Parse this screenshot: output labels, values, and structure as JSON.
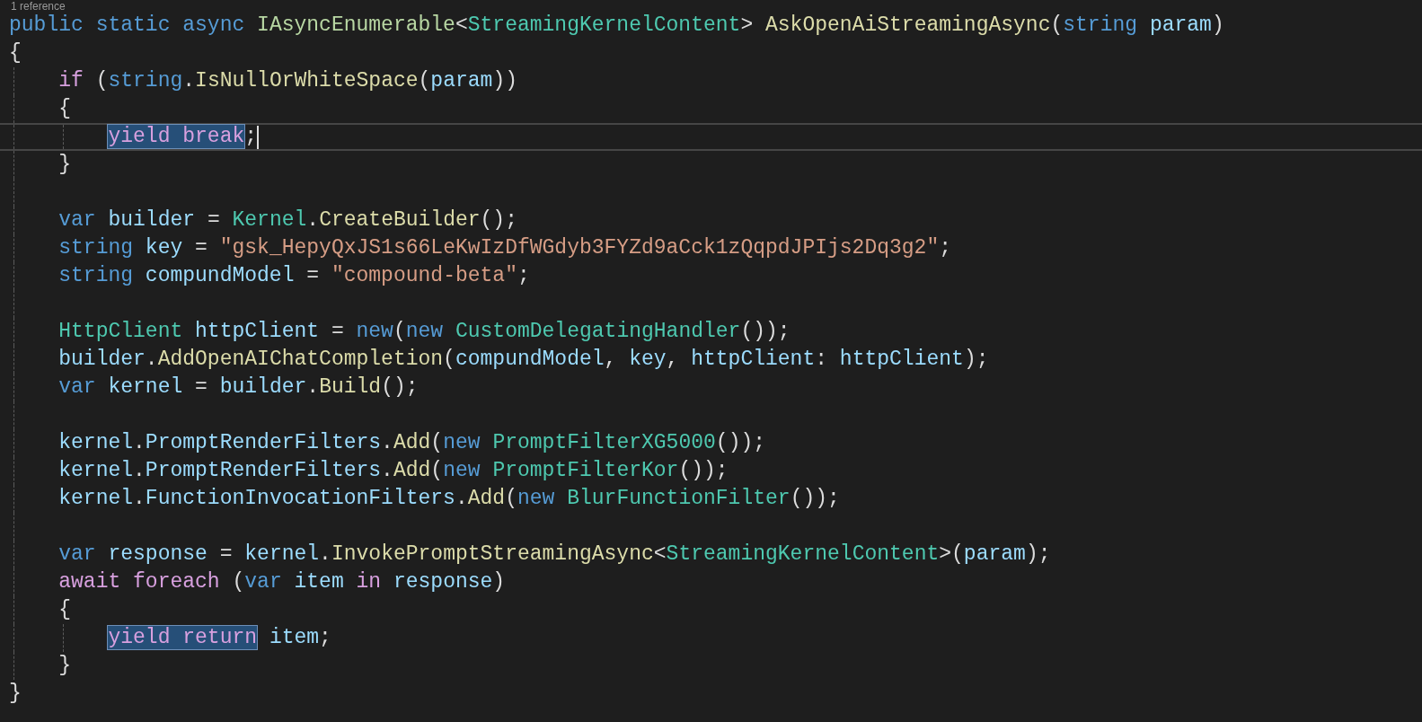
{
  "codelens": "1 reference",
  "lines": [
    {
      "current": false,
      "tokens": [
        {
          "kind": "keyword",
          "text": "public "
        },
        {
          "kind": "keyword",
          "text": "static "
        },
        {
          "kind": "keyword",
          "text": "async "
        },
        {
          "kind": "interface",
          "text": "IAsyncEnumerable"
        },
        {
          "kind": "punct",
          "text": "<"
        },
        {
          "kind": "type",
          "text": "StreamingKernelContent"
        },
        {
          "kind": "punct",
          "text": "> "
        },
        {
          "kind": "method",
          "text": "AskOpenAiStreamingAsync"
        },
        {
          "kind": "punct",
          "text": "("
        },
        {
          "kind": "keyword",
          "text": "string "
        },
        {
          "kind": "variable",
          "text": "param"
        },
        {
          "kind": "punct",
          "text": ")"
        }
      ]
    },
    {
      "current": false,
      "tokens": [
        {
          "kind": "punct",
          "text": "{"
        }
      ]
    },
    {
      "current": false,
      "tokens": [
        {
          "kind": "control",
          "text": "    if"
        },
        {
          "kind": "punct",
          "text": " ("
        },
        {
          "kind": "keyword",
          "text": "string"
        },
        {
          "kind": "punct",
          "text": "."
        },
        {
          "kind": "method",
          "text": "IsNullOrWhiteSpace"
        },
        {
          "kind": "punct",
          "text": "("
        },
        {
          "kind": "variable",
          "text": "param"
        },
        {
          "kind": "punct",
          "text": "))"
        }
      ]
    },
    {
      "current": false,
      "tokens": [
        {
          "kind": "punct",
          "text": "    {"
        }
      ]
    },
    {
      "current": true,
      "tokens": [
        {
          "kind": "control",
          "text": "        yield break",
          "highlighted": true
        },
        {
          "kind": "punct",
          "text": ";"
        }
      ]
    },
    {
      "current": false,
      "tokens": [
        {
          "kind": "punct",
          "text": "    }"
        }
      ]
    },
    {
      "current": false
    },
    {
      "current": false,
      "tokens": [
        {
          "kind": "keyword",
          "text": "    var "
        },
        {
          "kind": "variable",
          "text": "builder"
        },
        {
          "kind": "punct",
          "text": " = "
        },
        {
          "kind": "type",
          "text": "Kernel"
        },
        {
          "kind": "punct",
          "text": "."
        },
        {
          "kind": "method",
          "text": "CreateBuilder"
        },
        {
          "kind": "punct",
          "text": "();"
        }
      ]
    },
    {
      "current": false,
      "tokens": [
        {
          "kind": "keyword",
          "text": "    string "
        },
        {
          "kind": "variable",
          "text": "key"
        },
        {
          "kind": "punct",
          "text": " = "
        },
        {
          "kind": "string",
          "text": "\"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\""
        },
        {
          "kind": "punct",
          "text": ";"
        }
      ]
    },
    {
      "current": false,
      "tokens": [
        {
          "kind": "keyword",
          "text": "    string "
        },
        {
          "kind": "variable",
          "text": "compundModel"
        },
        {
          "kind": "punct",
          "text": " = "
        },
        {
          "kind": "string",
          "text": "\"compound-beta\""
        },
        {
          "kind": "punct",
          "text": ";"
        }
      ]
    },
    {
      "current": false
    },
    {
      "current": false,
      "tokens": [
        {
          "kind": "type",
          "text": "    HttpClient "
        },
        {
          "kind": "variable",
          "text": "httpClient"
        },
        {
          "kind": "punct",
          "text": " = "
        },
        {
          "kind": "keyword",
          "text": "new"
        },
        {
          "kind": "punct",
          "text": "("
        },
        {
          "kind": "keyword",
          "text": "new "
        },
        {
          "kind": "type",
          "text": "CustomDelegatingHandler"
        },
        {
          "kind": "punct",
          "text": "());"
        }
      ]
    },
    {
      "current": false,
      "tokens": [
        {
          "kind": "variable",
          "text": "    builder"
        },
        {
          "kind": "punct",
          "text": "."
        },
        {
          "kind": "method",
          "text": "AddOpenAIChatCompletion"
        },
        {
          "kind": "punct",
          "text": "("
        },
        {
          "kind": "variable",
          "text": "compundModel"
        },
        {
          "kind": "punct",
          "text": ", "
        },
        {
          "kind": "variable",
          "text": "key"
        },
        {
          "kind": "punct",
          "text": ", "
        },
        {
          "kind": "variable",
          "text": "httpClient"
        },
        {
          "kind": "punct",
          "text": ": "
        },
        {
          "kind": "variable",
          "text": "httpClient"
        },
        {
          "kind": "punct",
          "text": ");"
        }
      ]
    },
    {
      "current": false,
      "tokens": [
        {
          "kind": "keyword",
          "text": "    var "
        },
        {
          "kind": "variable",
          "text": "kernel"
        },
        {
          "kind": "punct",
          "text": " = "
        },
        {
          "kind": "variable",
          "text": "builder"
        },
        {
          "kind": "punct",
          "text": "."
        },
        {
          "kind": "method",
          "text": "Build"
        },
        {
          "kind": "punct",
          "text": "();"
        }
      ]
    },
    {
      "current": false
    },
    {
      "current": false,
      "tokens": [
        {
          "kind": "variable",
          "text": "    kernel"
        },
        {
          "kind": "punct",
          "text": "."
        },
        {
          "kind": "variable",
          "text": "PromptRenderFilters"
        },
        {
          "kind": "punct",
          "text": "."
        },
        {
          "kind": "method",
          "text": "Add"
        },
        {
          "kind": "punct",
          "text": "("
        },
        {
          "kind": "keyword",
          "text": "new "
        },
        {
          "kind": "type",
          "text": "PromptFilterXG5000"
        },
        {
          "kind": "punct",
          "text": "());"
        }
      ]
    },
    {
      "current": false,
      "tokens": [
        {
          "kind": "variable",
          "text": "    kernel"
        },
        {
          "kind": "punct",
          "text": "."
        },
        {
          "kind": "variable",
          "text": "PromptRenderFilters"
        },
        {
          "kind": "punct",
          "text": "."
        },
        {
          "kind": "method",
          "text": "Add"
        },
        {
          "kind": "punct",
          "text": "("
        },
        {
          "kind": "keyword",
          "text": "new "
        },
        {
          "kind": "type",
          "text": "PromptFilterKor"
        },
        {
          "kind": "punct",
          "text": "());"
        }
      ]
    },
    {
      "current": false,
      "tokens": [
        {
          "kind": "variable",
          "text": "    kernel"
        },
        {
          "kind": "punct",
          "text": "."
        },
        {
          "kind": "variable",
          "text": "FunctionInvocationFilters"
        },
        {
          "kind": "punct",
          "text": "."
        },
        {
          "kind": "method",
          "text": "Add"
        },
        {
          "kind": "punct",
          "text": "("
        },
        {
          "kind": "keyword",
          "text": "new "
        },
        {
          "kind": "type",
          "text": "BlurFunctionFilter"
        },
        {
          "kind": "punct",
          "text": "());"
        }
      ]
    },
    {
      "current": false
    },
    {
      "current": false,
      "tokens": [
        {
          "kind": "keyword",
          "text": "    var "
        },
        {
          "kind": "variable",
          "text": "response"
        },
        {
          "kind": "punct",
          "text": " = "
        },
        {
          "kind": "variable",
          "text": "kernel"
        },
        {
          "kind": "punct",
          "text": "."
        },
        {
          "kind": "method",
          "text": "InvokePromptStreamingAsync"
        },
        {
          "kind": "punct",
          "text": "<"
        },
        {
          "kind": "type",
          "text": "StreamingKernelContent"
        },
        {
          "kind": "punct",
          "text": ">("
        },
        {
          "kind": "variable",
          "text": "param"
        },
        {
          "kind": "punct",
          "text": ");"
        }
      ]
    },
    {
      "current": false,
      "tokens": [
        {
          "kind": "control",
          "text": "    await foreach"
        },
        {
          "kind": "punct",
          "text": " ("
        },
        {
          "kind": "keyword",
          "text": "var "
        },
        {
          "kind": "variable",
          "text": "item "
        },
        {
          "kind": "control",
          "text": "in "
        },
        {
          "kind": "variable",
          "text": "response"
        },
        {
          "kind": "punct",
          "text": ")"
        }
      ]
    },
    {
      "current": false,
      "tokens": [
        {
          "kind": "punct",
          "text": "    {"
        }
      ]
    },
    {
      "current": false,
      "tokens": [
        {
          "kind": "control",
          "text": "        yield return",
          "highlighted": true
        },
        {
          "kind": "variable",
          "text": " item"
        },
        {
          "kind": "punct",
          "text": ";"
        }
      ]
    },
    {
      "current": false,
      "tokens": [
        {
          "kind": "punct",
          "text": "    }"
        }
      ]
    },
    {
      "current": false,
      "tokens": [
        {
          "kind": "punct",
          "text": "}"
        }
      ]
    }
  ]
}
